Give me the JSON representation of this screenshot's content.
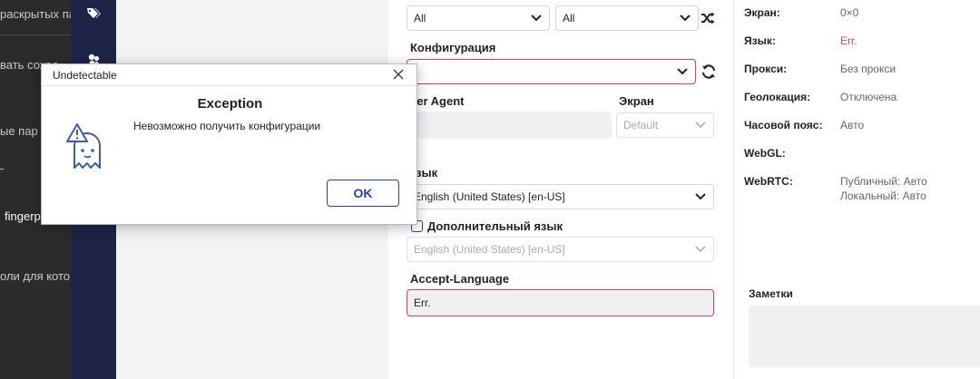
{
  "left_panel": {
    "texts": [
      "раскрытых па",
      "вать сохра",
      "ые пар",
      "fingerp",
      "оли для кото"
    ]
  },
  "sidebar": {
    "icons": [
      "tag-icon",
      "cookie-icon"
    ]
  },
  "form": {
    "top_select_1": "All",
    "top_select_2": "All",
    "config_label": "Конфигурация",
    "config_value": "",
    "user_agent_label": "ser Agent",
    "screen_label": "Экран",
    "screen_value": "Default",
    "language_label": "зык",
    "language_value": "English (United States) [en-US]",
    "additional_language_label": "Дополнительный язык",
    "additional_language_value": "English (United States) [en-US]",
    "accept_language_label": "Accept-Language",
    "accept_language_value": "Err."
  },
  "info": {
    "rows": [
      {
        "key": "Экран:",
        "value": "0×0"
      },
      {
        "key": "Язык:",
        "value": "Err."
      },
      {
        "key": "Прокси:",
        "value": "Без прокси"
      },
      {
        "key": "Геолокация:",
        "value": "Отключена"
      },
      {
        "key": "Часовой пояс:",
        "value": "Авто"
      },
      {
        "key": "WebGL:",
        "value": ""
      },
      {
        "key": "WebRTC:",
        "value": "Публичный: Авто",
        "value2": "Локальный: Авто"
      }
    ],
    "notes_label": "Заметки",
    "error_color": "#c4456a"
  },
  "dialog": {
    "window_title": "Undetectable",
    "heading": "Exception",
    "message": "Невозможно получить конфигурации",
    "ok_label": "OK"
  },
  "colors": {
    "navy": "#1e2447",
    "accent": "#2a3fa8",
    "error_border": "#d33f6a"
  }
}
